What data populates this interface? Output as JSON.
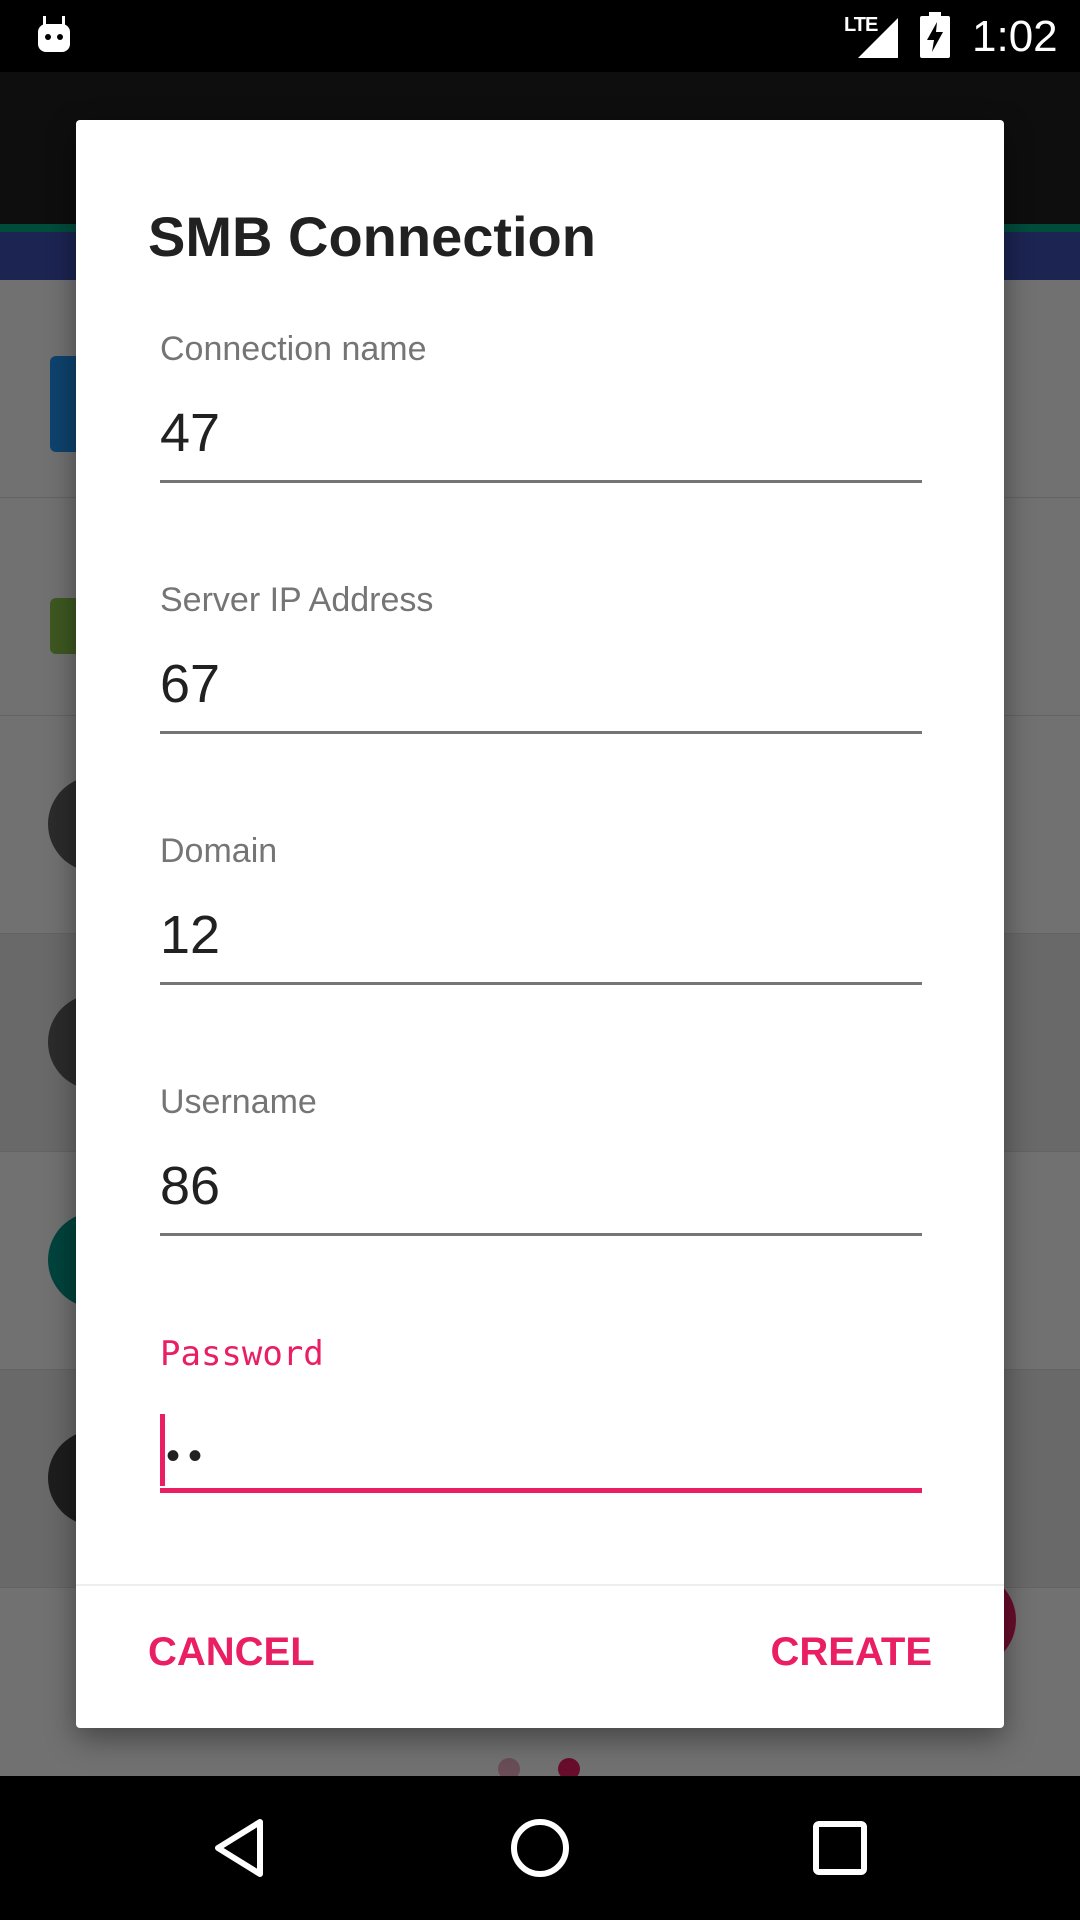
{
  "status_bar": {
    "network": "LTE",
    "time": "1:02"
  },
  "dialog": {
    "title": "SMB Connection",
    "fields": [
      {
        "label": "Connection name",
        "value": "47"
      },
      {
        "label": "Server IP Address",
        "value": "67"
      },
      {
        "label": "Domain",
        "value": "12"
      },
      {
        "label": "Username",
        "value": "86"
      },
      {
        "label": "Password",
        "value": "••"
      }
    ],
    "cancel_label": "CANCEL",
    "create_label": "CREATE"
  },
  "colors": {
    "accent": "#e91e63",
    "toolbar": "#212121",
    "tab_bar": "#3f51b5"
  }
}
